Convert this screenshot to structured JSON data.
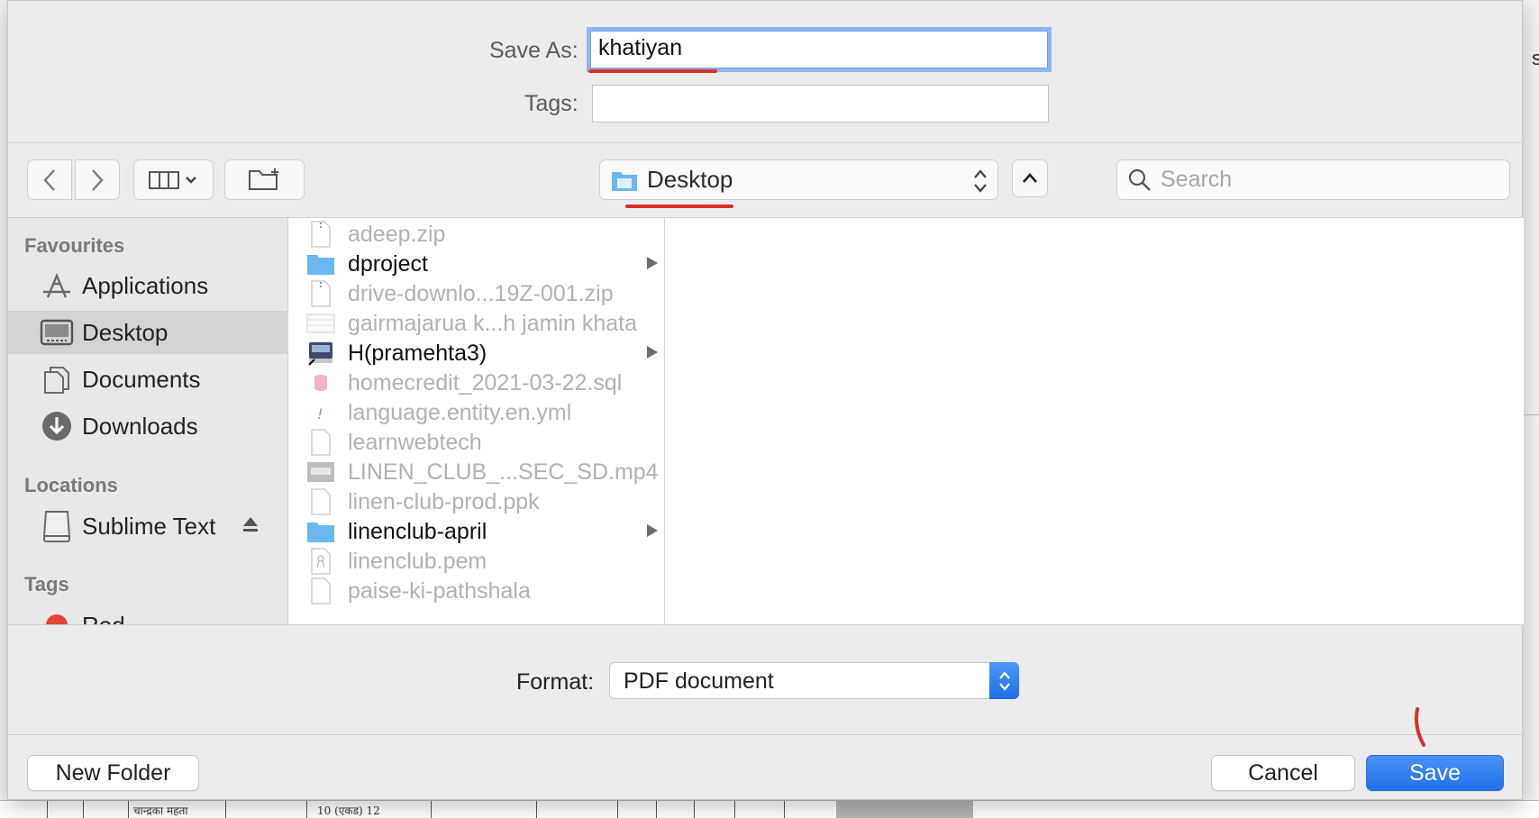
{
  "dialog": {
    "save_as_label": "Save As:",
    "save_as_value": "khatiyan",
    "tags_label": "Tags:",
    "tags_value": ""
  },
  "toolbar": {
    "location": "Desktop",
    "search_placeholder": "Search"
  },
  "sidebar": {
    "favourites_heading": "Favourites",
    "locations_heading": "Locations",
    "tags_heading": "Tags",
    "favourites": [
      {
        "label": "Applications",
        "icon": "applications-icon"
      },
      {
        "label": "Desktop",
        "icon": "desktop-icon",
        "selected": true
      },
      {
        "label": "Documents",
        "icon": "documents-icon"
      },
      {
        "label": "Downloads",
        "icon": "downloads-icon"
      }
    ],
    "locations": [
      {
        "label": "Sublime Text",
        "icon": "disk-icon"
      }
    ],
    "tags": [
      {
        "label": "Red",
        "color": "#e5453a"
      }
    ]
  },
  "files": [
    {
      "name": "adeep.zip",
      "icon": "zip-icon",
      "enabled": false
    },
    {
      "name": "dproject",
      "icon": "folder-icon",
      "enabled": true,
      "folder": true
    },
    {
      "name": "drive-downlo...19Z-001.zip",
      "icon": "zip-icon",
      "enabled": false
    },
    {
      "name": "gairmajarua k...h jamin khata",
      "icon": "spreadsheet-icon",
      "enabled": false
    },
    {
      "name": "H(pramehta3)",
      "icon": "network-drive-icon",
      "enabled": true,
      "folder": true
    },
    {
      "name": "homecredit_2021-03-22.sql",
      "icon": "sql-icon",
      "enabled": false
    },
    {
      "name": "language.entity.en.yml",
      "icon": "yml-icon",
      "enabled": false
    },
    {
      "name": "learnwebtech",
      "icon": "document-icon",
      "enabled": false
    },
    {
      "name": "LINEN_CLUB_...SEC_SD.mp4",
      "icon": "video-icon",
      "enabled": false
    },
    {
      "name": "linen-club-prod.ppk",
      "icon": "document-icon",
      "enabled": false
    },
    {
      "name": "linenclub-april",
      "icon": "folder-icon",
      "enabled": true,
      "folder": true
    },
    {
      "name": "linenclub.pem",
      "icon": "certificate-icon",
      "enabled": false
    },
    {
      "name": "paise-ki-pathshala",
      "icon": "document-icon",
      "enabled": false
    }
  ],
  "format": {
    "label": "Format:",
    "value": "PDF document"
  },
  "buttons": {
    "new_folder": "New Folder",
    "cancel": "Cancel",
    "save": "Save"
  },
  "background": {
    "hindi_text": "चान्द्रका महता",
    "area_text": "10 (एकड) 12"
  },
  "colors": {
    "accent": "#2270ec",
    "annotation_red": "#d8322b",
    "folder_blue": "#6ab8f0"
  }
}
